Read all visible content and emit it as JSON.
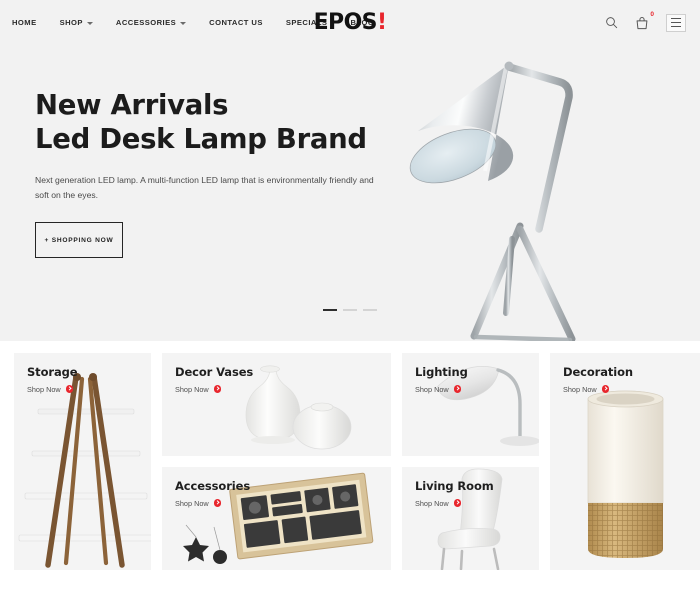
{
  "header": {
    "nav": [
      {
        "label": "HOME",
        "caret": false
      },
      {
        "label": "SHOP",
        "caret": true
      },
      {
        "label": "ACCESSORIES",
        "caret": true
      },
      {
        "label": "CONTACT US",
        "caret": false
      },
      {
        "label": "SPECIALS",
        "caret": false
      },
      {
        "label": "BLOG",
        "caret": false
      }
    ],
    "logo_text": "EPOS",
    "logo_accent": "!",
    "search_icon": "search-icon",
    "cart_icon": "shopping-bag-icon",
    "cart_count": "0",
    "menu_icon": "hamburger-menu-icon",
    "accent_color": "#e8262d",
    "background": "#f2f2f2"
  },
  "hero": {
    "title_line1": "New Arrivals",
    "title_line2": "Led Desk Lamp Brand",
    "subtitle": "Next generation LED lamp. A multi-function LED lamp that is environmentally friendly and soft on the eyes.",
    "cta_label": "+ Shopping Now",
    "slides": [
      {
        "active": true
      },
      {
        "active": false
      },
      {
        "active": false
      }
    ],
    "image_alt": "silver tripod led desk lamp"
  },
  "categories": [
    {
      "title": "Storage",
      "shop_label": "Shop Now",
      "art": "ladder-shelf",
      "span": "tall"
    },
    {
      "title": "Decor Vases",
      "shop_label": "Shop Now",
      "art": "white-vases",
      "span": "wide"
    },
    {
      "title": "Lighting",
      "shop_label": "Shop Now",
      "art": "desk-lamp",
      "span": "single"
    },
    {
      "title": "Decoration",
      "shop_label": "Shop Now",
      "art": "rattan-vase",
      "span": "tall"
    },
    {
      "title": "Accessories",
      "shop_label": "Shop Now",
      "art": "tool-tray",
      "span": "wide"
    },
    {
      "title": "Living Room",
      "shop_label": "Shop Now",
      "art": "white-chair",
      "span": "single"
    }
  ]
}
